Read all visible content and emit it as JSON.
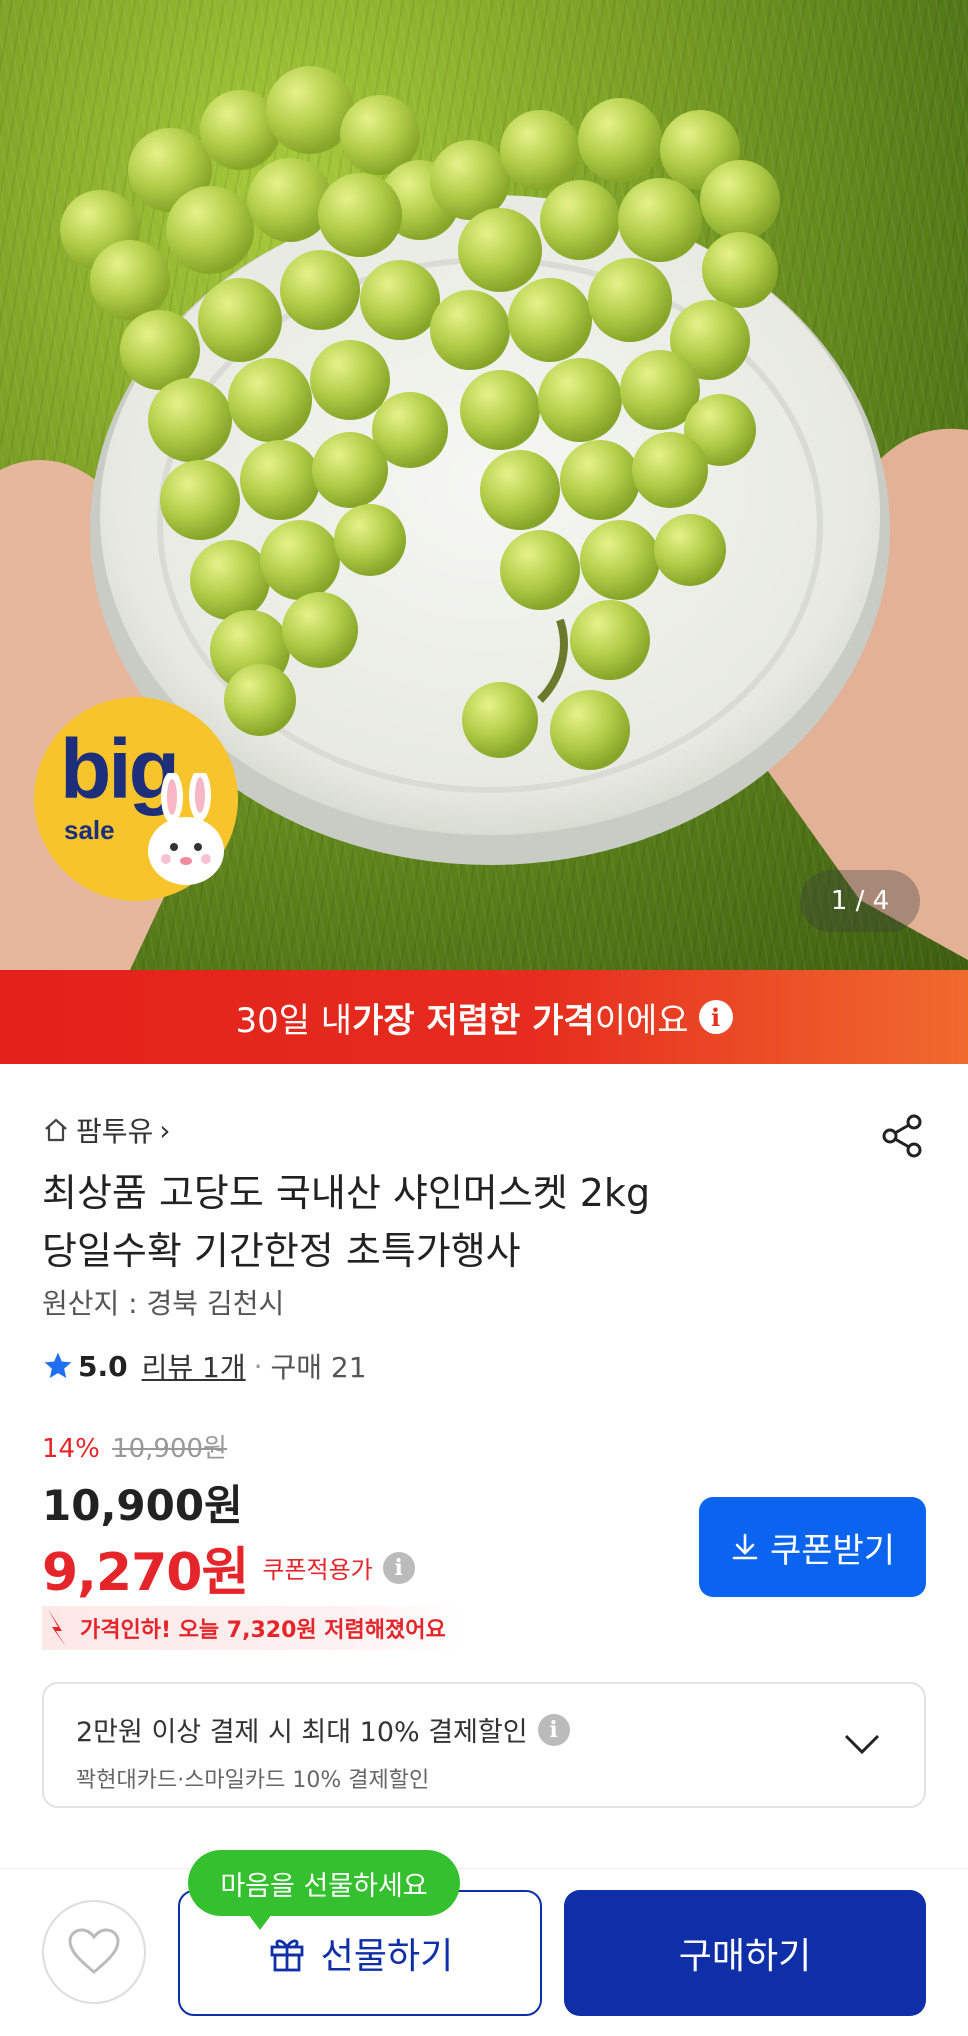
{
  "hero": {
    "badge_big": "big",
    "badge_sale": "sale",
    "image_counter": "1 / 4"
  },
  "banner": {
    "prefix": "30일 내 ",
    "highlight": "가장 저렴한 가격",
    "suffix": "이에요",
    "info_icon": "i",
    "color_start": "#e3221b",
    "color_end": "#f06a2e"
  },
  "store": {
    "name": "팜투유",
    "chevron": "›"
  },
  "product": {
    "title_line1": "최상품 고당도 국내산 샤인머스켓 2kg",
    "title_line2": "당일수확 기간한정 초특가행사",
    "origin": "원산지 : 경북 김천시"
  },
  "rating": {
    "score": "5.0",
    "review": "리뷰 1개",
    "separator": "·",
    "purchases": "구매 21"
  },
  "price": {
    "discount_pct": "14%",
    "original": "10,900원",
    "main": "10,900원",
    "sale": "9,270원",
    "sale_label": "쿠폰적용가",
    "info_icon": "i",
    "drop_text": "가격인하! 오늘 7,320원 저렴해졌어요"
  },
  "coupon": {
    "label": "쿠폰받기",
    "color": "#0a64f0"
  },
  "payment": {
    "line1": "2만원 이상 결제 시 최대  10% 결제할인",
    "info_icon": "i",
    "line2": "꽉현대카드·스마일카드 10% 결제할인"
  },
  "bottom": {
    "gift_bubble": "마음을 선물하세요",
    "gift_label": "선물하기",
    "buy_label": "구매하기",
    "bubble_color": "#35c12f",
    "primary_color": "#0f2fa8"
  },
  "icons": [
    "home-icon",
    "chevron-right-icon",
    "share-icon",
    "star-icon",
    "info-icon",
    "download-icon",
    "chevron-down-icon",
    "heart-icon",
    "gift-icon",
    "price-drop-arrow-icon"
  ]
}
